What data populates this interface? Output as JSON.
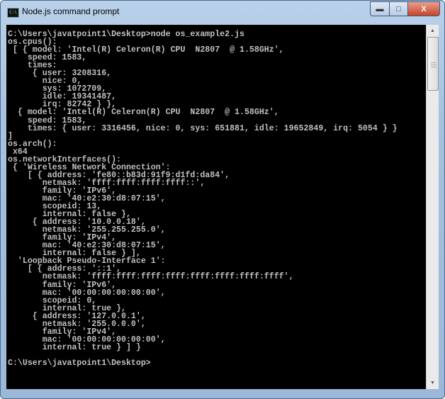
{
  "window": {
    "title": "Node.js command prompt",
    "icon": "cmd-icon",
    "icon_label": "C:\\"
  },
  "controls": {
    "minimize": "minimize-icon",
    "maximize": "maximize-icon",
    "close": "close-icon"
  },
  "console": {
    "lines": [
      "C:\\Users\\javatpoint1\\Desktop>node os_example2.js",
      "os.cpus():",
      " [ { model: 'Intel(R) Celeron(R) CPU  N2807  @ 1.58GHz',",
      "    speed: 1583,",
      "    times:",
      "     { user: 3208316,",
      "       nice: 0,",
      "       sys: 1072709,",
      "       idle: 19341487,",
      "       irq: 82742 } },",
      "  { model: 'Intel(R) Celeron(R) CPU  N2807  @ 1.58GHz',",
      "    speed: 1583,",
      "    times: { user: 3316456, nice: 0, sys: 651881, idle: 19652849, irq: 5054 } }",
      "]",
      "os.arch():",
      " x64",
      "os.networkInterfaces():",
      " { 'Wireless Network Connection':",
      "    [ { address: 'fe80::b83d:91f9:d1fd:da84',",
      "       netmask: 'ffff:ffff:ffff:ffff::',",
      "       family: 'IPv6',",
      "       mac: '40:e2:30:d8:07:15',",
      "       scopeid: 13,",
      "       internal: false },",
      "     { address: '10.0.0.18',",
      "       netmask: '255.255.255.0',",
      "       family: 'IPv4',",
      "       mac: '40:e2:30:d8:07:15',",
      "       internal: false } ],",
      "  'Loopback Pseudo-Interface 1':",
      "    [ { address: '::1',",
      "       netmask: 'ffff:ffff:ffff:ffff:ffff:ffff:ffff:ffff',",
      "       family: 'IPv6',",
      "       mac: '00:00:00:00:00:00',",
      "       scopeid: 0,",
      "       internal: true },",
      "     { address: '127.0.0.1',",
      "       netmask: '255.0.0.0',",
      "       family: 'IPv4',",
      "       mac: '00:00:00:00:00:00',",
      "       internal: true } ] }",
      "",
      "C:\\Users\\javatpoint1\\Desktop>"
    ]
  }
}
